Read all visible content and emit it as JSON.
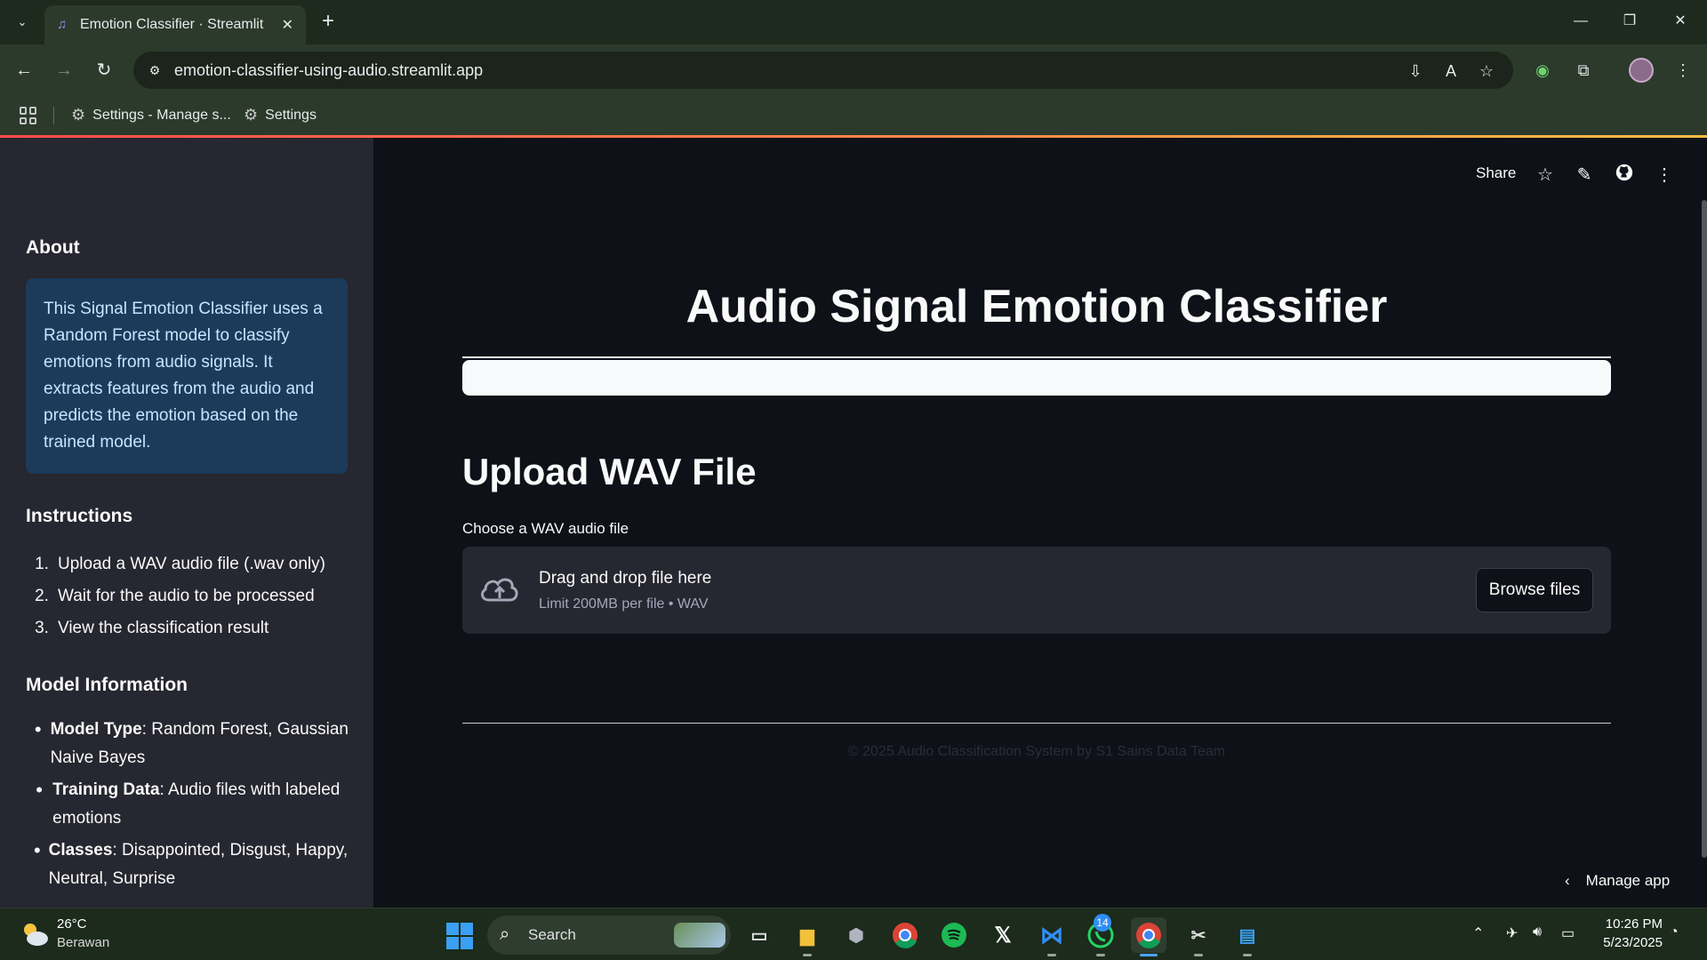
{
  "browser": {
    "tab_title": "Emotion Classifier · Streamlit",
    "url": "emotion-classifier-using-audio.streamlit.app",
    "bookmarks": [
      {
        "label": "Settings - Manage s..."
      },
      {
        "label": "Settings"
      }
    ]
  },
  "app_header": {
    "share_label": "Share"
  },
  "sidebar": {
    "about_heading": "About",
    "about_text": "This Signal Emotion Classifier uses a Random Forest model to classify emotions from audio signals. It extracts features from the audio and predicts the emotion based on the trained model.",
    "instructions_heading": "Instructions",
    "instructions": [
      {
        "num": "1.",
        "text": "Upload a WAV audio file (.wav only)"
      },
      {
        "num": "2.",
        "text": "Wait for the audio to be processed"
      },
      {
        "num": "3.",
        "text": "View the classification result"
      }
    ],
    "model_heading": "Model Information",
    "model_info": [
      {
        "key": "Model Type",
        "value": ": Random Forest, Gaussian Naive Bayes"
      },
      {
        "key": "Training Data",
        "value": ": Audio files with labeled emotions"
      },
      {
        "key": "Classes",
        "value": ": Disappointed, Disgust, Happy, Neutral, Surprise"
      }
    ]
  },
  "main": {
    "title": "Audio Signal Emotion Classifier",
    "upload_heading": "Upload WAV File",
    "uploader_label": "Choose a WAV audio file",
    "dropzone_title": "Drag and drop file here",
    "dropzone_limit": "Limit 200MB per file • WAV",
    "browse_label": "Browse files",
    "footer": "© 2025 Audio Classification System by S1 Sains Data Team",
    "manage_app": "Manage app"
  },
  "taskbar": {
    "weather_temp": "26°C",
    "weather_cond": "Berawan",
    "search_placeholder": "Search",
    "whatsapp_badge": "14",
    "time": "10:26 PM",
    "date": "5/23/2025"
  },
  "colors": {
    "sidebar_bg": "#262730",
    "main_bg": "#0e1117",
    "info_bg": "#1c3a5a",
    "accent_gradient_start": "#ff4b4b",
    "accent_gradient_end": "#ffbd45"
  }
}
